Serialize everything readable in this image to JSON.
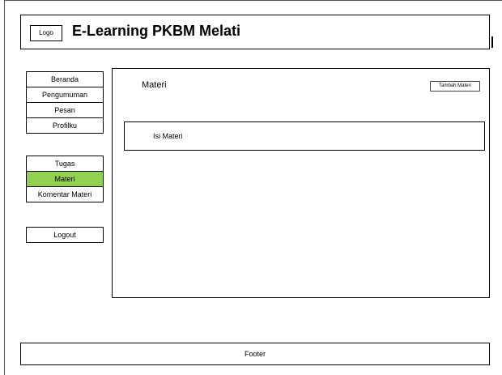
{
  "header": {
    "logo_label": "Logo",
    "title": "E-Learning PKBM Melati"
  },
  "sidebar": {
    "group1": [
      {
        "label": "Beranda"
      },
      {
        "label": "Pengumuman"
      },
      {
        "label": "Pesan"
      },
      {
        "label": "Profilku"
      }
    ],
    "group2": [
      {
        "label": "Tugas"
      },
      {
        "label": "Materi",
        "active": true
      },
      {
        "label": "Komentar Materi"
      }
    ],
    "logout_label": "Logout",
    "active_color": "#92d050"
  },
  "main": {
    "title": "Materi",
    "add_button_label": "Tambah Materi",
    "items": [
      {
        "label": "Isi Materi"
      }
    ]
  },
  "footer": {
    "label": "Footer"
  }
}
